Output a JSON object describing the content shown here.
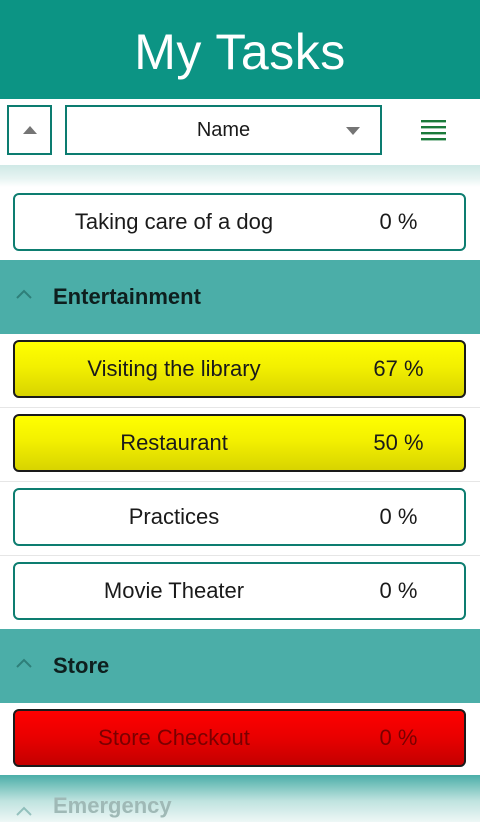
{
  "app": {
    "title": "My Tasks"
  },
  "toolbar": {
    "sort_field": "Name",
    "sort_direction_icon": "triangle-up-icon",
    "dropdown_icon": "triangle-down-icon",
    "menu_icon": "hamburger-menu-icon"
  },
  "colors": {
    "header_bg": "#0c9484",
    "group_bg": "#4baea8",
    "border_teal": "#0d7d70",
    "status_yellow": "#ffff00",
    "status_red": "#ff0000"
  },
  "ungrouped": [
    {
      "name": "Taking care of a dog",
      "progress": "0 %"
    }
  ],
  "groups": [
    {
      "title": "Entertainment",
      "tasks": [
        {
          "name": "Visiting the library",
          "progress": "67 %"
        },
        {
          "name": "Restaurant",
          "progress": "50 %"
        },
        {
          "name": "Practices",
          "progress": "0 %"
        },
        {
          "name": "Movie Theater",
          "progress": "0 %"
        }
      ]
    },
    {
      "title": "Store",
      "tasks": [
        {
          "name": "Store Checkout",
          "progress": "0 %"
        }
      ]
    },
    {
      "title": "Emergency",
      "tasks": []
    }
  ]
}
